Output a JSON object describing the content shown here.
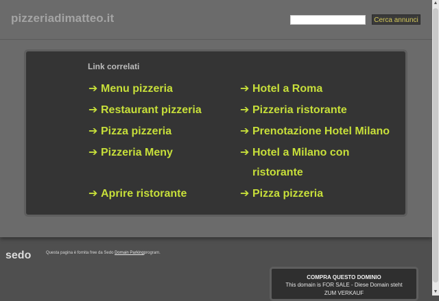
{
  "header": {
    "site_title": "pizzeriadimatteo.it",
    "search_value": "",
    "search_button": "Cerca annunci"
  },
  "links": {
    "heading": "Link correlati",
    "arrow": "➔",
    "left": [
      "Menu pizzeria",
      "Restaurant pizzeria",
      "Pizza pizzeria",
      "Pizzeria Meny",
      "Aprire ristorante"
    ],
    "right": [
      "Hotel a Roma",
      "Pizzeria ristorante",
      "Prenotazione Hotel Milano",
      "Hotel a Milano con",
      "Pizza pizzeria"
    ],
    "right_line2": "ristorante"
  },
  "footer": {
    "logo": "sedo",
    "text_before": "Questa pagina è fornita free da Sedo ",
    "link_text": "Domain Parking",
    "text_after": "program."
  },
  "sale_box": {
    "title": "COMPRA QUESTO DOMINIO",
    "desc_line1": "This domain is FOR SALE - Diese Domain steht",
    "desc_line2": "ZUM VERKAUF"
  },
  "colors": {
    "background": "#4f4f4f",
    "band": "#6b6b6b",
    "panel": "#343434",
    "link": "#c7df3a"
  }
}
